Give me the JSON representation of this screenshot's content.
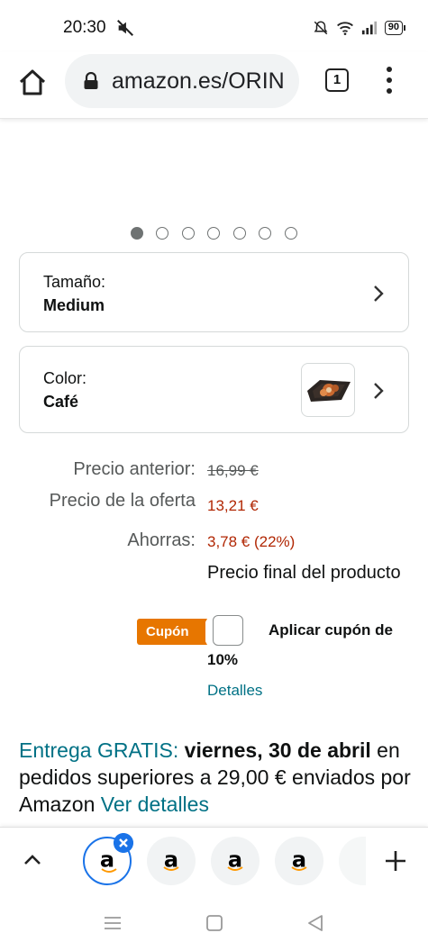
{
  "status_bar": {
    "time": "20:30",
    "battery": "90"
  },
  "browser": {
    "url": "amazon.es/ORIN",
    "tab_count": "1"
  },
  "carousel": {
    "total": 7,
    "active_index": 0
  },
  "size_selector": {
    "label": "Tamaño:",
    "value": "Medium"
  },
  "color_selector": {
    "label": "Color:",
    "value": "Café"
  },
  "price": {
    "previous_label": "Precio anterior:",
    "previous_value": "16,99 €",
    "deal_label": "Precio de la oferta",
    "deal_value": "13,21 €",
    "savings_label": "Ahorras:",
    "savings_value": "3,78 € (22%)",
    "final_note": "Precio final del producto"
  },
  "coupon": {
    "badge": "Cupón",
    "apply_text_1": "Aplicar cupón de",
    "apply_text_2": "10%",
    "details_link": "Detalles"
  },
  "delivery": {
    "free_label": "Entrega GRATIS:",
    "date": "viernes, 30 de abril",
    "text_mid": " en pedidos superiores a 29,00 € enviados por Amazon ",
    "details_link": "Ver detalles"
  },
  "tab_strip": {
    "tab_logo": "a"
  },
  "colors": {
    "teal_link": "#007185",
    "price_red": "#b12704",
    "coupon_orange": "#e77600",
    "chrome_blue": "#1a73e8"
  }
}
